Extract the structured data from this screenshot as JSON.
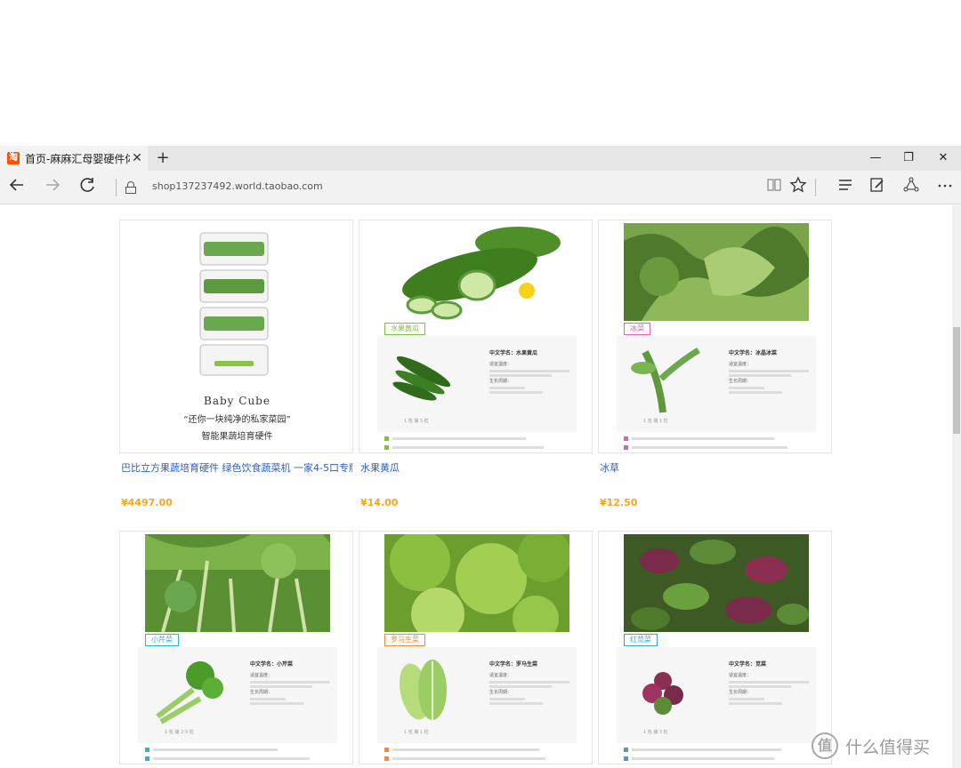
{
  "browser": {
    "tab_title": "首页-麻麻汇母婴硬件体",
    "tab_favicon": "淘",
    "tab_close": "✕",
    "new_tab": "+",
    "minimize": "—",
    "restore": "❐",
    "close": "✕",
    "address": "shop137237492.world.taobao.com",
    "icons": [
      "back-icon",
      "forward-icon",
      "refresh-icon",
      "lock-icon",
      "reading-view-icon",
      "favorite-star-icon",
      "hub-icon",
      "web-note-icon",
      "share-icon",
      "more-icon"
    ]
  },
  "products": [
    {
      "title": "巴比立方果蔬培育硬件 绿色饮食蔬菜机 一家4-5口专版",
      "price": "¥4497.00",
      "image": {
        "brand": "Baby Cube",
        "slogan": "“还你一块纯净的私家菜园”",
        "subtitle": "智能果蔬培育硬件"
      }
    },
    {
      "title": "水果黄瓜",
      "price": "¥14.00",
      "image": {
        "tag": "水果黄瓜",
        "tag_color": "#7cc142",
        "info_heading": "中文学名：水果黄瓜",
        "info_label1": "适宜温度：",
        "info_label2": "生长周期：",
        "caption": "1 包 播 5 粒"
      }
    },
    {
      "title": "冰草",
      "price": "¥12.50",
      "image": {
        "tag": "冰菜",
        "tag_color": "#e05fbf",
        "info_heading": "中文学名：冰晶冰菜",
        "info_label1": "适宜温度：",
        "info_label2": "生长周期：",
        "caption": "1 包 播 1 粒"
      }
    },
    {
      "title": "",
      "price": "",
      "image": {
        "tag": "小芹菜",
        "tag_color": "#2bb5c9",
        "info_heading": "中文学名：小芹菜",
        "info_label1": "适宜温度：",
        "info_label2": "生长周期：",
        "caption": "1 包 播 2-3 粒"
      }
    },
    {
      "title": "",
      "price": "",
      "image": {
        "tag": "罗马生菜",
        "tag_color": "#f08a3c",
        "info_heading": "中文学名：罗马生菜",
        "info_label1": "适宜温度：",
        "info_label2": "生长周期：",
        "caption": "1 包 播 1 粒"
      }
    },
    {
      "title": "",
      "price": "",
      "image": {
        "tag": "红苋菜",
        "tag_color": "#3fa0d8",
        "info_heading": "中文学名：苋菜",
        "info_label1": "适宜温度：",
        "info_label2": "生长周期：",
        "caption": "1 包 播 3 粒"
      }
    }
  ],
  "watermark": {
    "icon": "值",
    "text": "什么值得买"
  }
}
